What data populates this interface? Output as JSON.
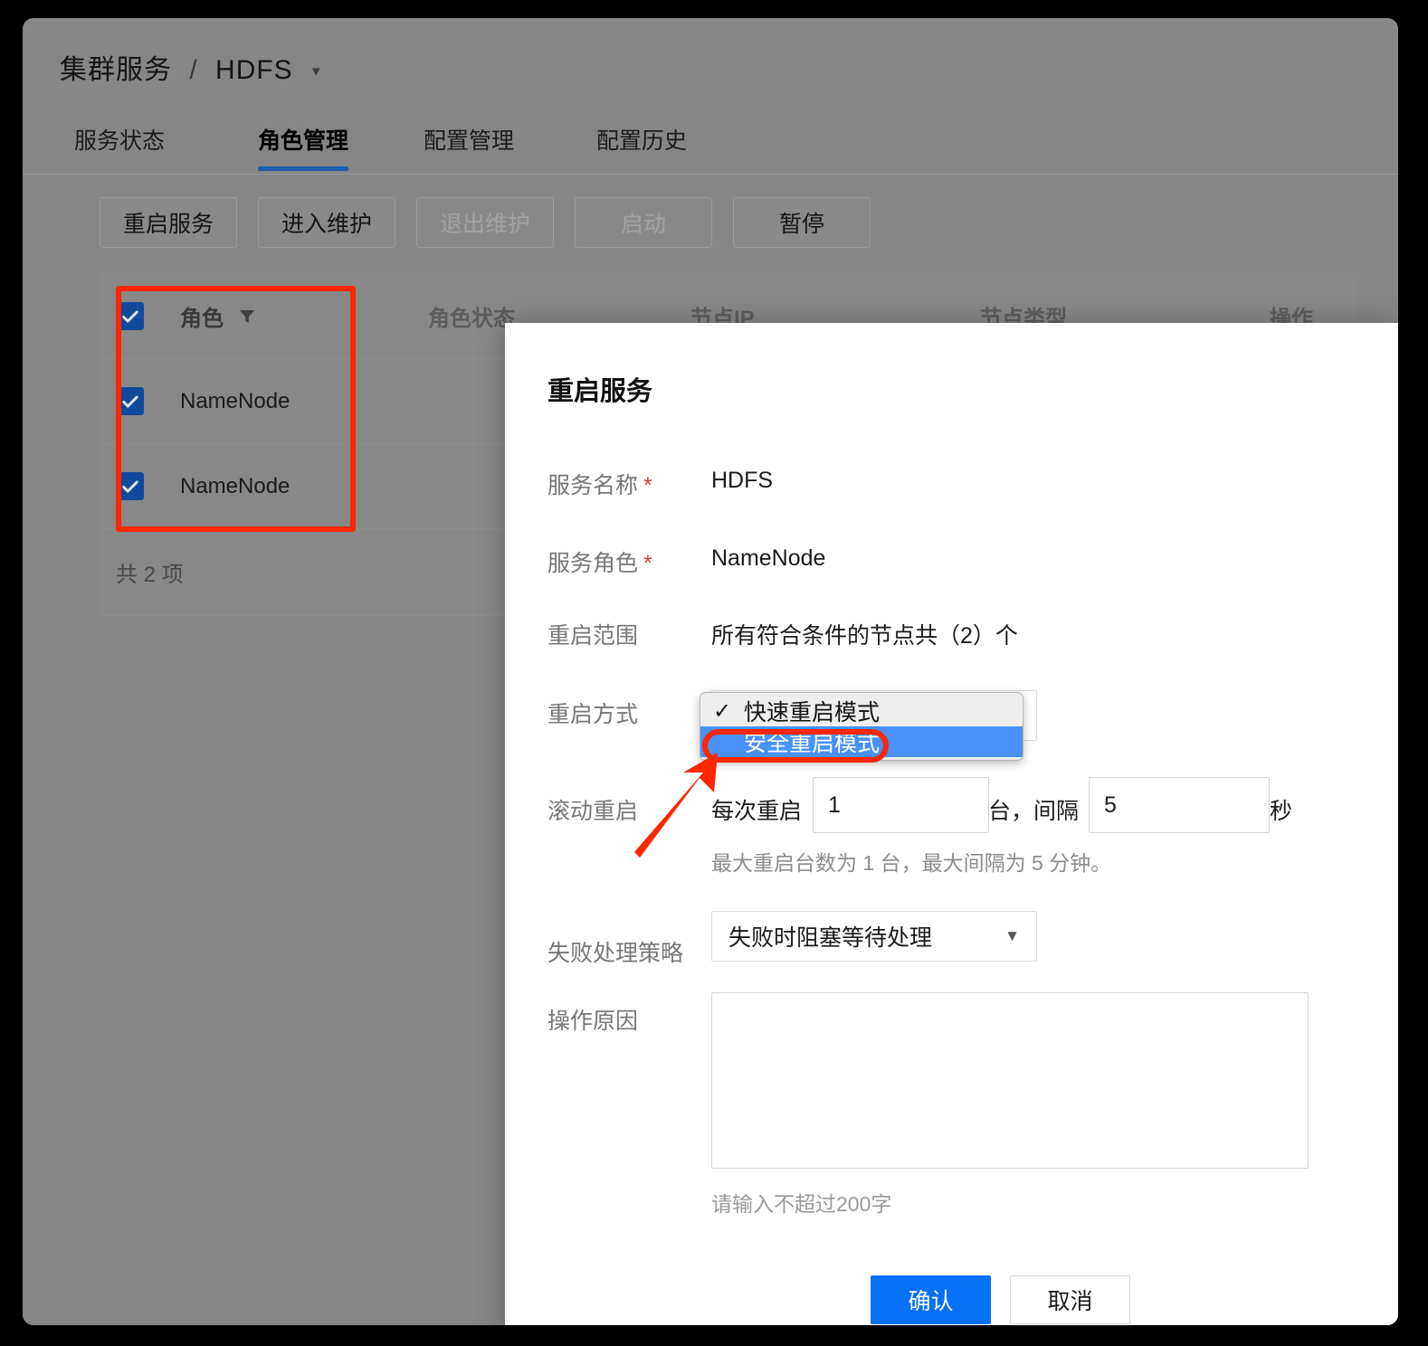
{
  "breadcrumb": {
    "root": "集群服务",
    "separator": "/",
    "current": "HDFS",
    "caret": "▾"
  },
  "tabs": [
    {
      "label": "服务状态",
      "active": false
    },
    {
      "label": "角色管理",
      "active": true
    },
    {
      "label": "配置管理",
      "active": false
    },
    {
      "label": "配置历史",
      "active": false
    }
  ],
  "toolbar": [
    {
      "label": "重启服务",
      "disabled": false
    },
    {
      "label": "进入维护",
      "disabled": false
    },
    {
      "label": "退出维护",
      "disabled": true
    },
    {
      "label": "启动",
      "disabled": true
    },
    {
      "label": "暂停",
      "disabled": false
    }
  ],
  "table": {
    "headers": {
      "role": "角色",
      "status": "角色状态",
      "ip": "节点IP",
      "type": "节点类型",
      "op": "操作"
    },
    "rows": [
      {
        "role": "NameNode",
        "checked": true
      },
      {
        "role": "NameNode",
        "checked": true
      }
    ],
    "footer_count": "共 2 项"
  },
  "modal": {
    "title": "重启服务",
    "fields": {
      "service_name_label": "服务名称",
      "service_name_value": "HDFS",
      "service_role_label": "服务角色",
      "service_role_value": "NameNode",
      "restart_scope_label": "重启范围",
      "restart_scope_value": "所有符合条件的节点共（2）个",
      "restart_mode_label": "重启方式",
      "rolling_restart_label": "滚动重启",
      "rolling_prefix": "每次重启",
      "rolling_count_value": "1",
      "rolling_mid": "台，间隔",
      "rolling_interval_value": "5",
      "rolling_suffix": "秒",
      "rolling_hint": "最大重启台数为 1 台，最大间隔为 5 分钟。",
      "failure_policy_label": "失败处理策略",
      "failure_policy_value": "失败时阻塞等待处理",
      "reason_label": "操作原因",
      "reason_value": "",
      "reason_hint": "请输入不超过200字"
    },
    "restart_mode_options": [
      {
        "label": "快速重启模式",
        "checked": true,
        "highlighted": false
      },
      {
        "label": "安全重启模式",
        "checked": false,
        "highlighted": true
      }
    ],
    "buttons": {
      "confirm": "确认",
      "cancel": "取消"
    }
  },
  "colors": {
    "accent_blue": "#0670f7",
    "tab_underline": "#1b5fad",
    "checkbox_blue": "#114a9b",
    "dropdown_highlight": "#4891f7",
    "annotation_red": "#ff2600",
    "required_red": "#e4393c",
    "page_overlay_gray": "#868686"
  }
}
